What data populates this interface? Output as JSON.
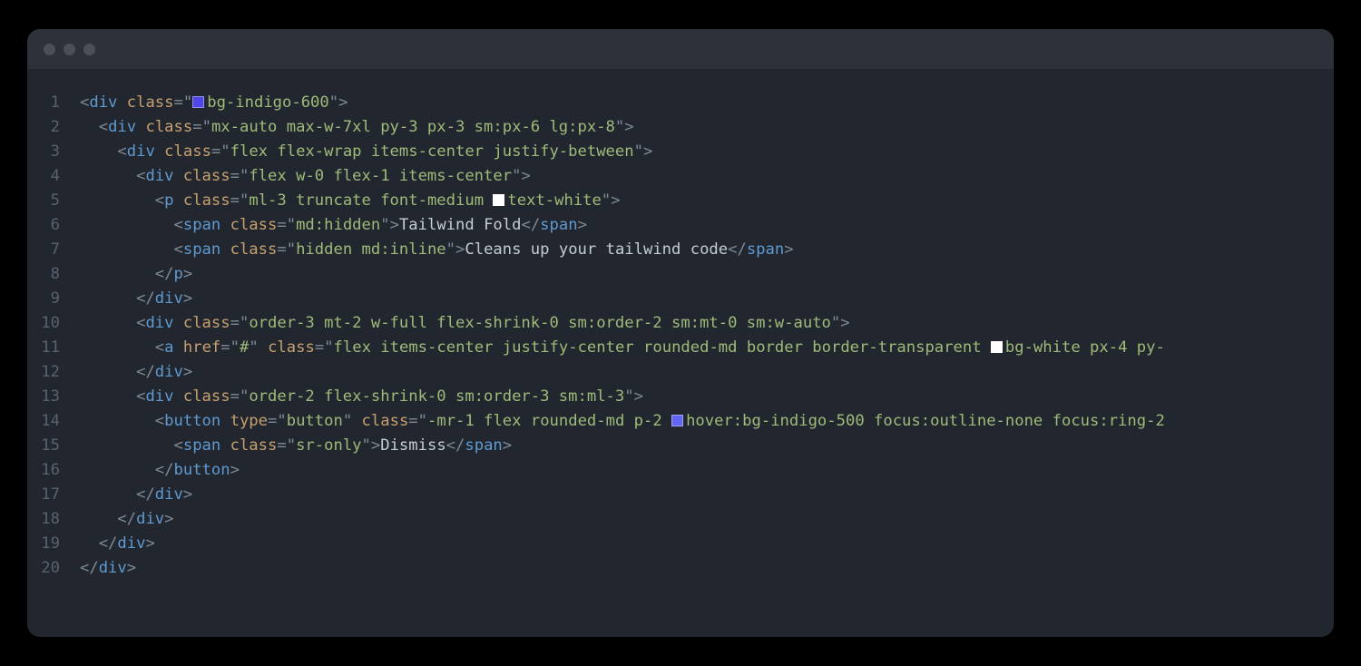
{
  "editor": {
    "lines": [
      {
        "n": 1,
        "indent": 0,
        "t": "open",
        "tag": "div",
        "attrs": [
          {
            "name": "class",
            "swatch": "indigo600",
            "value": "bg-indigo-600"
          }
        ]
      },
      {
        "n": 2,
        "indent": 1,
        "t": "open",
        "tag": "div",
        "attrs": [
          {
            "name": "class",
            "value": "mx-auto max-w-7xl py-3 px-3 sm:px-6 lg:px-8"
          }
        ]
      },
      {
        "n": 3,
        "indent": 2,
        "t": "open",
        "tag": "div",
        "attrs": [
          {
            "name": "class",
            "value": "flex flex-wrap items-center justify-between"
          }
        ]
      },
      {
        "n": 4,
        "indent": 3,
        "t": "open",
        "tag": "div",
        "attrs": [
          {
            "name": "class",
            "value": "flex w-0 flex-1 items-center"
          }
        ]
      },
      {
        "n": 5,
        "indent": 4,
        "t": "open",
        "tag": "p",
        "attrs": [
          {
            "name": "class",
            "swatch": "white",
            "swatchBefore": "text-white",
            "valuePrefix": "ml-3 truncate font-medium ",
            "value": "text-white"
          }
        ]
      },
      {
        "n": 6,
        "indent": 5,
        "t": "inline",
        "tag": "span",
        "attrs": [
          {
            "name": "class",
            "value": "md:hidden"
          }
        ],
        "text": "Tailwind Fold"
      },
      {
        "n": 7,
        "indent": 5,
        "t": "inline",
        "tag": "span",
        "attrs": [
          {
            "name": "class",
            "value": "hidden md:inline"
          }
        ],
        "text": "Cleans up your tailwind code"
      },
      {
        "n": 8,
        "indent": 4,
        "t": "close",
        "tag": "p"
      },
      {
        "n": 9,
        "indent": 3,
        "t": "close",
        "tag": "div"
      },
      {
        "n": 10,
        "indent": 3,
        "t": "open",
        "tag": "div",
        "attrs": [
          {
            "name": "class",
            "value": "order-3 mt-2 w-full flex-shrink-0 sm:order-2 sm:mt-0 sm:w-auto"
          }
        ]
      },
      {
        "n": 11,
        "indent": 4,
        "t": "open",
        "tag": "a",
        "noclose": true,
        "attrs": [
          {
            "name": "href",
            "value": "#"
          },
          {
            "name": "class",
            "swatch": "white",
            "swatchBefore": "bg-white",
            "valuePrefix": "flex items-center justify-center rounded-md border border-transparent ",
            "value": "bg-white px-4 py-"
          }
        ]
      },
      {
        "n": 12,
        "indent": 3,
        "t": "close",
        "tag": "div"
      },
      {
        "n": 13,
        "indent": 3,
        "t": "open",
        "tag": "div",
        "attrs": [
          {
            "name": "class",
            "value": "order-2 flex-shrink-0 sm:order-3 sm:ml-3"
          }
        ]
      },
      {
        "n": 14,
        "indent": 4,
        "t": "open",
        "tag": "button",
        "noclose": true,
        "attrs": [
          {
            "name": "type",
            "value": "button"
          },
          {
            "name": "class",
            "swatch": "indigo500",
            "swatchBefore": "hover:bg-indigo-500",
            "valuePrefix": "-mr-1 flex rounded-md p-2 ",
            "value": "hover:bg-indigo-500 focus:outline-none focus:ring-2 "
          }
        ]
      },
      {
        "n": 15,
        "indent": 5,
        "t": "inline",
        "tag": "span",
        "attrs": [
          {
            "name": "class",
            "value": "sr-only"
          }
        ],
        "text": "Dismiss"
      },
      {
        "n": 16,
        "indent": 4,
        "t": "close",
        "tag": "button"
      },
      {
        "n": 17,
        "indent": 3,
        "t": "close",
        "tag": "div"
      },
      {
        "n": 18,
        "indent": 2,
        "t": "close",
        "tag": "div"
      },
      {
        "n": 19,
        "indent": 1,
        "t": "close",
        "tag": "div"
      },
      {
        "n": 20,
        "indent": 0,
        "t": "close",
        "tag": "div"
      }
    ]
  }
}
